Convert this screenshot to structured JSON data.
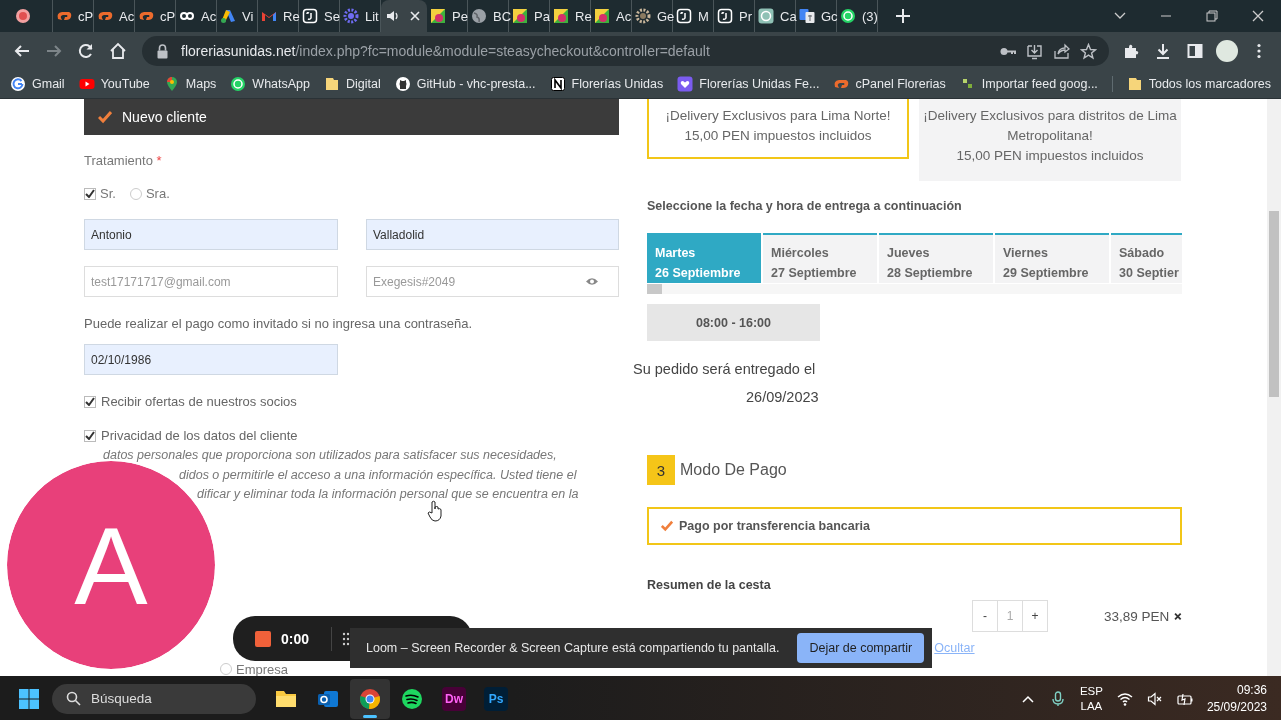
{
  "browser": {
    "tabs": [
      {
        "selected": false
      },
      {
        "label": "cP",
        "selected": false
      },
      {
        "label": "Ac",
        "selected": false
      },
      {
        "label": "cP",
        "selected": false
      },
      {
        "label": "Ac",
        "selected": false
      },
      {
        "label": "Vi",
        "selected": false
      },
      {
        "label": "Re",
        "selected": false
      },
      {
        "label": "Se",
        "selected": false
      },
      {
        "label": "Lit",
        "selected": false
      },
      {
        "selected": true
      },
      {
        "label": "Pe",
        "selected": false
      },
      {
        "label": "BC",
        "selected": false
      },
      {
        "label": "Pa",
        "selected": false
      },
      {
        "label": "Re",
        "selected": false
      },
      {
        "label": "Ac",
        "selected": false
      },
      {
        "label": "Ge",
        "selected": false
      },
      {
        "label": "M",
        "selected": false
      },
      {
        "label": "Pr",
        "selected": false
      },
      {
        "label": "Ca",
        "selected": false
      },
      {
        "label": "Gc",
        "selected": false
      },
      {
        "label": "(3)",
        "selected": false
      }
    ],
    "url_host": "floreriasunidas.net",
    "url_path": "/index.php?fc=module&module=steasycheckout&controller=default",
    "bookmarks": [
      {
        "label": "Gmail"
      },
      {
        "label": "YouTube"
      },
      {
        "label": "Maps"
      },
      {
        "label": "WhatsApp"
      },
      {
        "label": "Digital"
      },
      {
        "label": "GitHub - vhc-presta..."
      },
      {
        "label": "Florerías Unidas"
      },
      {
        "label": "Florerías Unidas Fe..."
      },
      {
        "label": "cPanel Florerias"
      },
      {
        "label": "Importar feed goog..."
      }
    ],
    "all_bookmarks": "Todos los marcadores"
  },
  "page": {
    "header": "Nuevo cliente",
    "treatment_label": "Tratamiento",
    "required_mark": "*",
    "titles": [
      {
        "label": "Sr.",
        "selected": true
      },
      {
        "label": "Sra.",
        "selected": false
      }
    ],
    "name_fields": [
      {
        "value": "Antonio"
      },
      {
        "value": "Valladolid"
      }
    ],
    "email": {
      "placeholder": "test17171717@gmail.com"
    },
    "password": {
      "placeholder": "Exegesis#2049"
    },
    "guest_note": "Puede realizar el pago como invitado si no ingresa una contraseña.",
    "birthdate": {
      "value": "02/10/1986"
    },
    "checkboxes": [
      {
        "label": "Recibir ofertas de nuestros socios",
        "checked": true
      },
      {
        "label": "Privacidad de los datos del cliente",
        "checked": true
      }
    ],
    "privacy_lines": [
      "datos personales que proporciona son utilizados para satisfacer sus necesidades,",
      "didos o permitirle el acceso a una información específica. Usted tiene el",
      "dificar y eliminar toda la información personal que se encuentra en la"
    ],
    "company_radio": {
      "label": "Empresa",
      "selected": false
    },
    "carriers": [
      {
        "lines": [
          "¡Delivery Exclusivos para Lima Norte!",
          "15,00 PEN impuestos incluidos"
        ],
        "selected": true
      },
      {
        "lines": [
          "¡Delivery Exclusivos para distritos de Lima Metropolitana!",
          "15,00 PEN impuestos incluidos"
        ],
        "selected": false
      }
    ],
    "date_prompt": "Seleccione la fecha y hora de entrega a continuación",
    "days": [
      {
        "weekday": "Martes",
        "date": "26 Septiembre",
        "selected": true
      },
      {
        "weekday": "Miércoles",
        "date": "27 Septiembre",
        "selected": false
      },
      {
        "weekday": "Jueves",
        "date": "28 Septiembre",
        "selected": false
      },
      {
        "weekday": "Viernes",
        "date": "29 Septiembre",
        "selected": false
      },
      {
        "weekday": "Sábado",
        "date": "30 Septier",
        "selected": false
      }
    ],
    "time_slots": [
      {
        "label": "08:00 - 16:00"
      }
    ],
    "delivery_note": "Su pedido será entregado el",
    "delivery_date": "26/09/2023",
    "step_number": "3",
    "step_title": "Modo De Pago",
    "payment_options": [
      {
        "label": "Pago por transferencia bancaria",
        "selected": true
      }
    ],
    "cart_title": "Resumen de la cesta",
    "cart_item": {
      "minus": "-",
      "quantity": "1",
      "plus": "+",
      "price": "33,89 PEN"
    }
  },
  "overlays": {
    "avatar_letter": "A",
    "recorder_time": "0:00",
    "share_message": "Loom – Screen Recorder & Screen Capture está compartiendo tu pantalla.",
    "stop_button": "Dejar de compartir",
    "hide_link": "Ocultar"
  },
  "taskbar": {
    "search_placeholder": "Búsqueda",
    "apps": [
      {
        "selected": false
      },
      {
        "selected": false
      },
      {
        "selected": true
      },
      {
        "selected": false
      },
      {
        "label": "Dw",
        "selected": false
      },
      {
        "label": "Ps",
        "selected": false
      }
    ],
    "language": "ESP",
    "layout": "LAA",
    "time": "09:36",
    "date": "25/09/2023"
  }
}
